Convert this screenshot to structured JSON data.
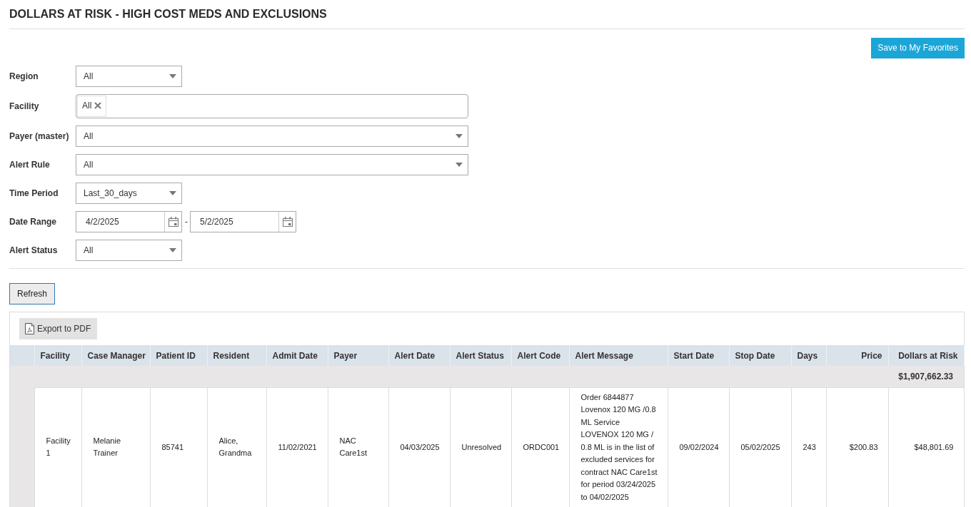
{
  "page": {
    "title": "DOLLARS AT RISK - HIGH COST MEDS AND EXCLUSIONS",
    "favorites_button": "Save to My Favorites"
  },
  "filters": [
    {
      "kind": "dropdown",
      "label": "Region",
      "value": "All"
    },
    {
      "kind": "tags",
      "label": "Facility",
      "tags": [
        "All"
      ]
    },
    {
      "kind": "dropdown",
      "label": "Payer (master)",
      "value": "All"
    },
    {
      "kind": "dropdown",
      "label": "Alert Rule",
      "value": "All"
    },
    {
      "kind": "dropdown",
      "label": "Time Period",
      "value": "Last_30_days"
    },
    {
      "kind": "daterange",
      "label": "Date Range",
      "from": "4/2/2025",
      "separator": "-",
      "to": "5/2/2025"
    },
    {
      "kind": "dropdown",
      "label": "Alert Status",
      "value": "All"
    }
  ],
  "refresh_button": "Refresh",
  "grid": {
    "export_button": "Export to PDF",
    "columns": [
      "Facility",
      "Case Manager",
      "Patient ID",
      "Resident",
      "Admit Date",
      "Payer",
      "Alert Date",
      "Alert Status",
      "Alert Code",
      "Alert Message",
      "Start Date",
      "Stop Date",
      "Days",
      "Price",
      "Dollars at Risk"
    ],
    "total": "$1,907,662.33",
    "rows": [
      {
        "cells": [
          "Facility 1",
          "Melanie Trainer",
          "85741",
          "Alice, Grandma",
          "11/02/2021",
          "NAC Care1st",
          "04/03/2025",
          "Unresolved",
          "ORDC001",
          "Order 6844877 Lovenox 120 MG /0.8 ML Service LOVENOX 120 MG / 0.8 ML is in the list of excluded services for contract NAC Care1st for period 03/24/2025 to 04/02/2025",
          "09/02/2024",
          "05/02/2025",
          "243",
          "$200.83",
          "$48,801.69"
        ]
      }
    ]
  }
}
